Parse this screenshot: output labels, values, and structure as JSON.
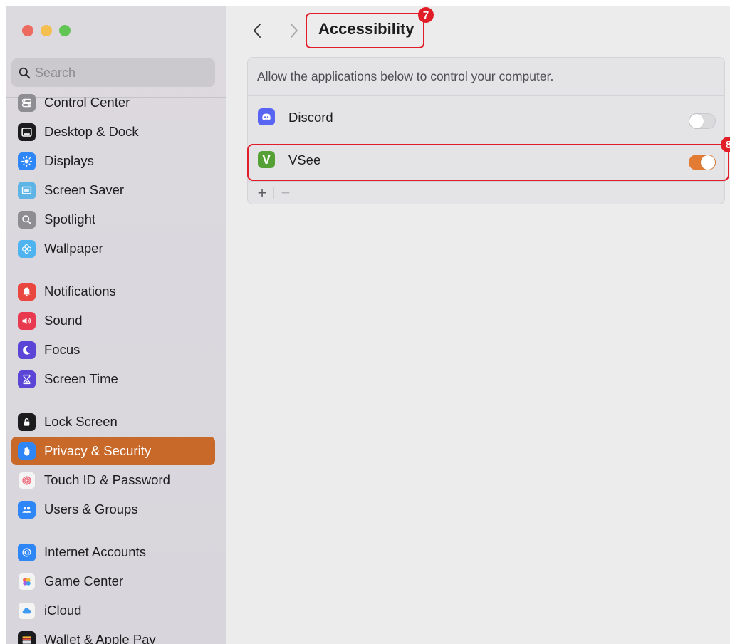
{
  "window": {
    "traffic_lights": [
      "close",
      "minimize",
      "zoom"
    ]
  },
  "sidebar": {
    "search": {
      "placeholder": "Search",
      "value": ""
    },
    "selected_color": "#c8692a",
    "items": [
      {
        "label": "Control Center",
        "icon": "control-center-icon",
        "color": "#8e8d92"
      },
      {
        "label": "Desktop & Dock",
        "icon": "desktop-dock-icon",
        "color": "#1c1c1e"
      },
      {
        "label": "Displays",
        "icon": "displays-icon",
        "color": "#2f86f6"
      },
      {
        "label": "Screen Saver",
        "icon": "screen-saver-icon",
        "color": "#5fb4e6"
      },
      {
        "label": "Spotlight",
        "icon": "spotlight-icon",
        "color": "#8e8d92"
      },
      {
        "label": "Wallpaper",
        "icon": "wallpaper-icon",
        "color": "#4fb3f0"
      },
      {
        "label": "Notifications",
        "icon": "notifications-icon",
        "color": "#e9473f"
      },
      {
        "label": "Sound",
        "icon": "sound-icon",
        "color": "#e9394f"
      },
      {
        "label": "Focus",
        "icon": "focus-icon",
        "color": "#5a45d6"
      },
      {
        "label": "Screen Time",
        "icon": "screen-time-icon",
        "color": "#5a45d6"
      },
      {
        "label": "Lock Screen",
        "icon": "lock-screen-icon",
        "color": "#1c1c1e"
      },
      {
        "label": "Privacy & Security",
        "icon": "privacy-hand-icon",
        "color": "#2f86f6",
        "selected": true
      },
      {
        "label": "Touch ID & Password",
        "icon": "fingerprint-icon",
        "color": "#f4f4f4"
      },
      {
        "label": "Users & Groups",
        "icon": "users-groups-icon",
        "color": "#2f86f6"
      },
      {
        "label": "Internet Accounts",
        "icon": "internet-accounts-icon",
        "color": "#2f86f6"
      },
      {
        "label": "Game Center",
        "icon": "game-center-icon",
        "color": "#f4f4f4"
      },
      {
        "label": "iCloud",
        "icon": "icloud-icon",
        "color": "#f4f4f4"
      },
      {
        "label": "Wallet & Apple Pay",
        "icon": "wallet-icon",
        "color": "#1c1c1e"
      }
    ]
  },
  "header": {
    "title": "Accessibility",
    "back_icon": "chevron-left-icon",
    "forward_icon": "chevron-right-icon"
  },
  "annotations": [
    {
      "number": "7",
      "target": "page-title",
      "color": "#e11d27"
    },
    {
      "number": "8",
      "target": "vsee-row",
      "color": "#e11d27"
    }
  ],
  "panel": {
    "description": "Allow the applications below to control your computer.",
    "apps": [
      {
        "name": "Discord",
        "enabled": false,
        "icon": "discord-icon",
        "icon_color": "#5865f2"
      },
      {
        "name": "VSee",
        "enabled": true,
        "icon": "vsee-icon",
        "icon_color": "#56a136",
        "icon_letter": "V"
      }
    ],
    "add_label": "+",
    "remove_label": "−",
    "toggle_on_color": "#e27b34"
  }
}
